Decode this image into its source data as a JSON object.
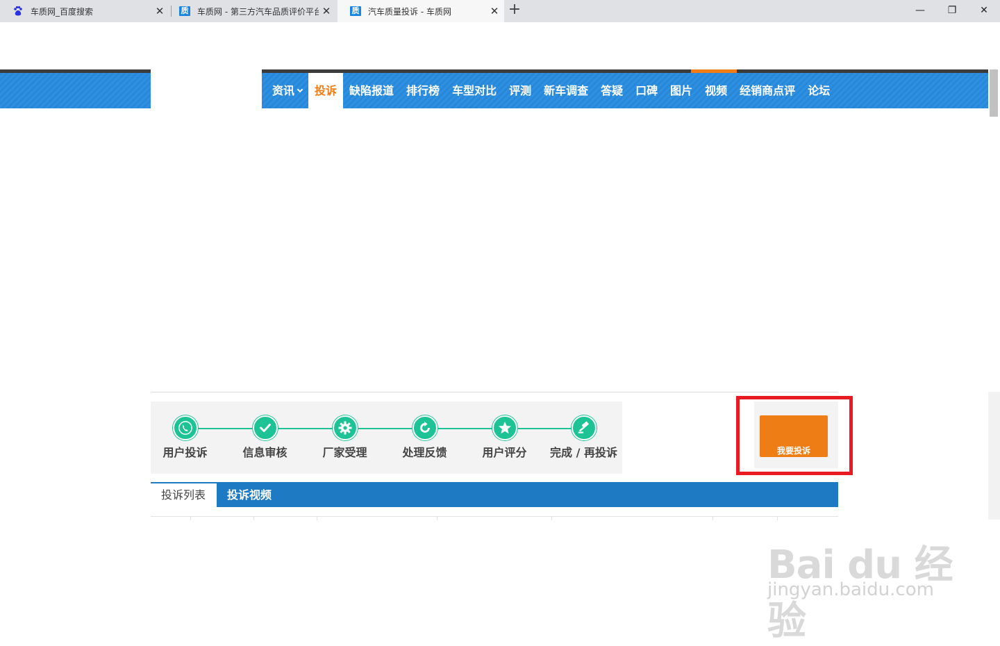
{
  "browser": {
    "tabs": [
      {
        "title": "车质网_百度搜索",
        "icon": "baidu-paw-icon",
        "active": false
      },
      {
        "title": "车质网 - 第三方汽车品质评价平台",
        "icon": "zhi-icon",
        "active": false
      },
      {
        "title": "汽车质量投诉 - 车质网",
        "icon": "zhi-icon",
        "active": true
      }
    ],
    "icon_glyph": "质",
    "new_tab": "+",
    "window": {
      "minimize": "—",
      "restore": "❐",
      "close": "✕"
    }
  },
  "nav": {
    "items": [
      "资讯",
      "投诉",
      "缺陷报道",
      "排行榜",
      "车型对比",
      "评测",
      "新车调查",
      "答疑",
      "口碑",
      "图片",
      "视频",
      "经销商点评",
      "论坛"
    ],
    "active_index": 1,
    "accent": "#f07c16",
    "nav_blue": "#2788da"
  },
  "process": {
    "steps": [
      {
        "label": "用户投诉",
        "icon": "phone-icon"
      },
      {
        "label": "信息审核",
        "icon": "checkmark-icon"
      },
      {
        "label": "厂家受理",
        "icon": "gear-icon"
      },
      {
        "label": "处理反馈",
        "icon": "refresh-icon"
      },
      {
        "label": "用户评分",
        "icon": "star-icon"
      },
      {
        "label": "完成 / 再投诉",
        "icon": "gavel-icon"
      }
    ],
    "step_color": "#1dc295"
  },
  "cta": {
    "label": "我要投诉",
    "color": "#ef7d15",
    "highlight_color": "#e81b23"
  },
  "list_tabs": [
    {
      "label": "投诉列表",
      "active": true
    },
    {
      "label": "投诉视频",
      "active": false
    }
  ],
  "watermark": {
    "brand": "Bai du 经验",
    "url": "jingyan.baidu.com"
  }
}
